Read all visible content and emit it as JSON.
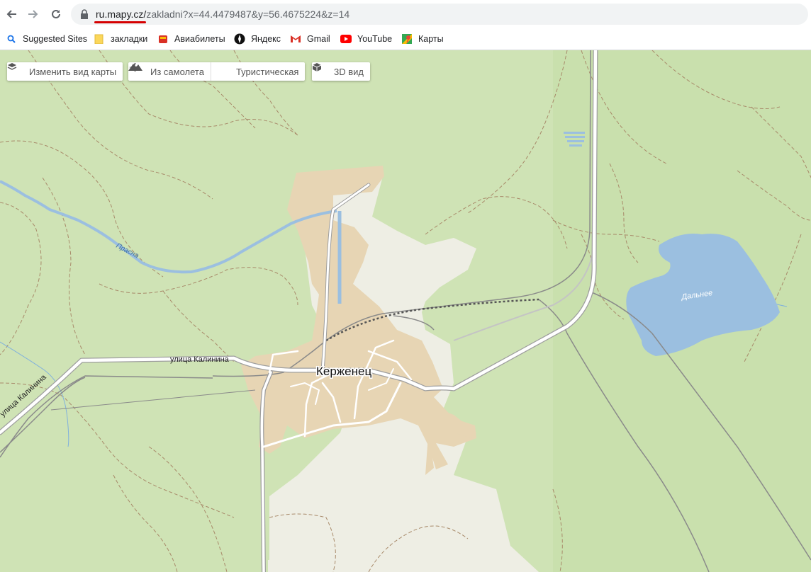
{
  "browser": {
    "url_host": "ru.mapy.cz/",
    "url_path": "zakladni?x=44.4479487&y=56.4675224&z=14",
    "nav": {
      "back_icon": "arrow-left-icon",
      "forward_icon": "arrow-right-icon",
      "reload_icon": "reload-icon"
    },
    "bookmarks": [
      {
        "label": "Suggested Sites",
        "icon": "search-icon"
      },
      {
        "label": "закладки",
        "icon": "folder-icon"
      },
      {
        "label": "Авиабилеты",
        "icon": "ticket-icon"
      },
      {
        "label": "Яндекс",
        "icon": "compass-icon"
      },
      {
        "label": "Gmail",
        "icon": "gmail-icon"
      },
      {
        "label": "YouTube",
        "icon": "youtube-icon"
      },
      {
        "label": "Карты",
        "icon": "maps-pin-icon"
      }
    ]
  },
  "map": {
    "controls": {
      "change_view": "Изменить вид карты",
      "aerial": "Из самолета",
      "tourist": "Туристическая",
      "view3d": "3D вид"
    },
    "labels": {
      "town": "Керженец",
      "river": "Прасна",
      "lake": "Дальнее",
      "street_1": "улица Калинина",
      "street_2": "улица Калинина"
    },
    "colors": {
      "land": "#cfe3b5",
      "field": "#eeeee4",
      "settlement": "#e7d5b4",
      "water": "#9bbfe0",
      "road": "#ffffff",
      "track": "#a88a6a"
    }
  }
}
